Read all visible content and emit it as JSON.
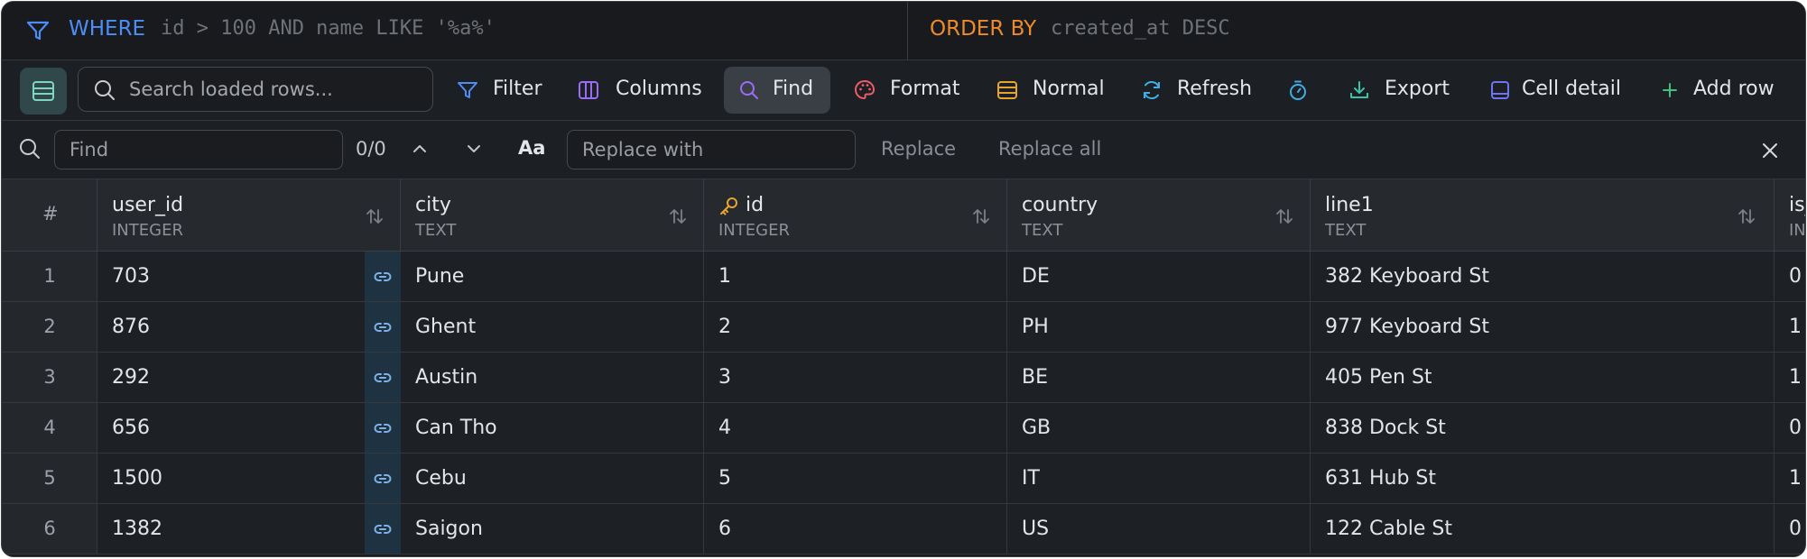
{
  "filter": {
    "where_label": "WHERE",
    "where_expr": "id > 100 AND name LIKE '%a%'",
    "orderby_label": "ORDER BY",
    "orderby_expr": "created_at DESC"
  },
  "toolbar": {
    "search_placeholder": "Search loaded rows...",
    "filter_label": "Filter",
    "columns_label": "Columns",
    "find_label": "Find",
    "format_label": "Format",
    "density_label": "Normal",
    "refresh_label": "Refresh",
    "export_label": "Export",
    "cell_detail_label": "Cell detail",
    "add_row_label": "Add row"
  },
  "find": {
    "find_placeholder": "Find",
    "count": "0/0",
    "case_label": "Aa",
    "replace_placeholder": "Replace with",
    "replace_label": "Replace",
    "replace_all_label": "Replace all"
  },
  "table": {
    "rownum_header": "#",
    "columns": [
      {
        "name": "user_id",
        "type": "INTEGER"
      },
      {
        "name": "city",
        "type": "TEXT"
      },
      {
        "name": "id",
        "type": "INTEGER"
      },
      {
        "name": "country",
        "type": "TEXT"
      },
      {
        "name": "line1",
        "type": "TEXT"
      },
      {
        "name": "is_",
        "type": "IN"
      }
    ],
    "rows": [
      {
        "n": "1",
        "user_id": "703",
        "city": "Pune",
        "id": "1",
        "country": "DE",
        "line1": "382 Keyboard St",
        "is": "0"
      },
      {
        "n": "2",
        "user_id": "876",
        "city": "Ghent",
        "id": "2",
        "country": "PH",
        "line1": "977 Keyboard St",
        "is": "1"
      },
      {
        "n": "3",
        "user_id": "292",
        "city": "Austin",
        "id": "3",
        "country": "BE",
        "line1": "405 Pen St",
        "is": "1"
      },
      {
        "n": "4",
        "user_id": "656",
        "city": "Can Tho",
        "id": "4",
        "country": "GB",
        "line1": "838 Dock St",
        "is": "0"
      },
      {
        "n": "5",
        "user_id": "1500",
        "city": "Cebu",
        "id": "5",
        "country": "IT",
        "line1": "631 Hub St",
        "is": "1"
      },
      {
        "n": "6",
        "user_id": "1382",
        "city": "Saigon",
        "id": "6",
        "country": "US",
        "line1": "122 Cable St",
        "is": "0"
      }
    ]
  },
  "colors": {
    "where": "#4d8df7",
    "orderby": "#ec8a2c",
    "key": "#e5a530",
    "fk_link": "#7fb0e6"
  }
}
